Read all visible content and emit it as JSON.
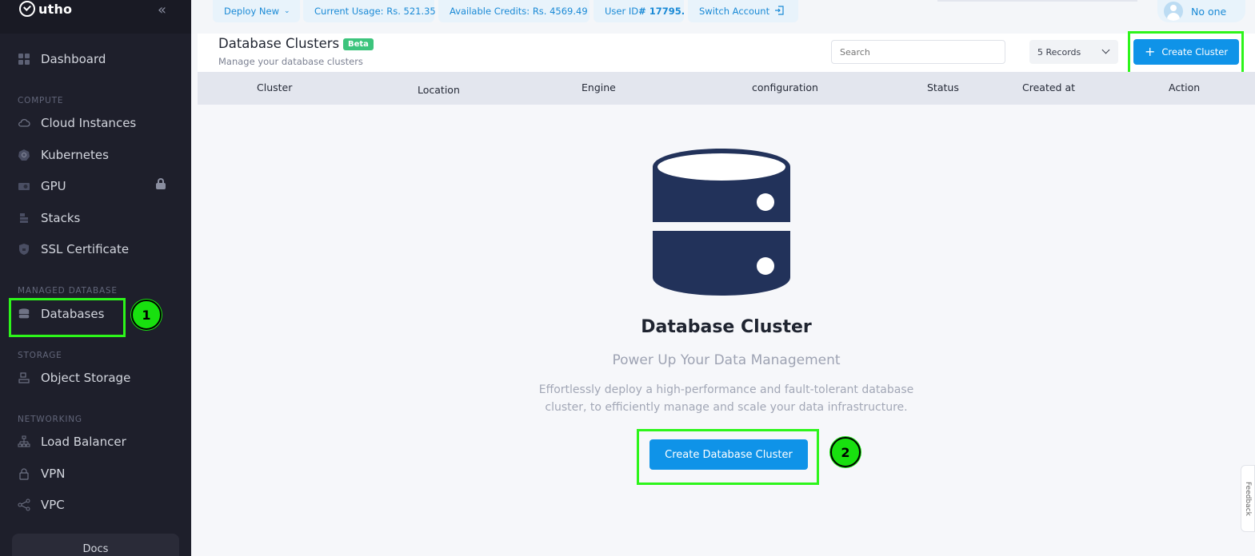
{
  "app": {
    "logo_text": "utho"
  },
  "sidebar": {
    "dashboard": "Dashboard",
    "sections": {
      "compute": "COMPUTE",
      "managed_database": "MANAGED DATABASE",
      "storage": "STORAGE",
      "networking": "NETWORKING"
    },
    "items": {
      "cloud_instances": "Cloud Instances",
      "kubernetes": "Kubernetes",
      "gpu": "GPU",
      "stacks": "Stacks",
      "ssl": "SSL Certificate",
      "databases": "Databases",
      "object_storage": "Object Storage",
      "load_balancer": "Load Balancer",
      "vpn": "VPN",
      "vpc": "VPC"
    },
    "docs": "Docs"
  },
  "topbar": {
    "deploy_new": "Deploy New",
    "current_usage": "Current Usage: Rs. 521.35",
    "available_credits": "Available Credits: Rs. 4569.49",
    "user_id_label": "User ID ",
    "user_id_value": "# 17795.",
    "switch_account": "Switch Account",
    "user_name": "No one"
  },
  "header": {
    "title": "Database Clusters",
    "beta": "Beta",
    "subtitle": "Manage your database clusters",
    "search_placeholder": "Search",
    "records": "5 Records",
    "create_button": "Create Cluster"
  },
  "table": {
    "columns": [
      "Cluster",
      "Location",
      "Engine",
      "configuration",
      "Status",
      "Created at",
      "Action"
    ]
  },
  "empty_state": {
    "title": "Database Cluster",
    "subtitle": "Power Up Your Data Management",
    "description": "Effortlessly deploy a high-performance and fault-tolerant database cluster, to efficiently manage and scale your data infrastructure.",
    "cta": "Create Database Cluster"
  },
  "annotations": {
    "step1": "1",
    "step2": "2"
  },
  "feedback": "Feedback",
  "colors": {
    "accent": "#0f93e8",
    "highlight": "#2df51a",
    "sidebar_bg": "#1e1f2b",
    "db_icon": "#22325a"
  }
}
